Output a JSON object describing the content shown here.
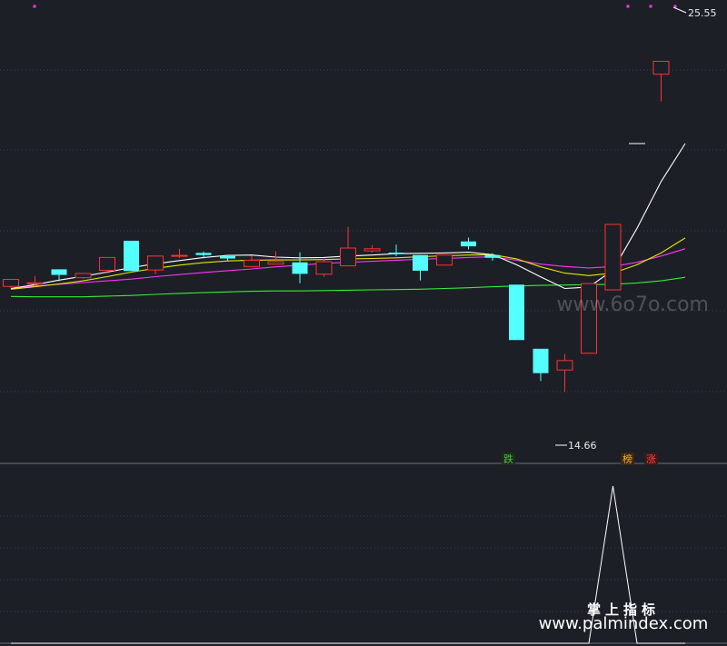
{
  "chart_data": [
    {
      "type": "candlestick",
      "ylim": [
        12.6,
        25.9
      ],
      "grid": true,
      "candles": [
        {
          "open": 17.68,
          "close": 17.88,
          "high": 17.88,
          "low": 17.62
        },
        {
          "open": 17.78,
          "close": 17.78,
          "high": 17.98,
          "low": 17.68
        },
        {
          "open": 18.17,
          "close": 18.01,
          "high": 18.17,
          "low": 17.83
        },
        {
          "open": 17.93,
          "close": 18.05,
          "high": 18.05,
          "low": 17.9
        },
        {
          "open": 18.14,
          "close": 18.51,
          "high": 18.51,
          "low": 18.05
        },
        {
          "open": 18.99,
          "close": 18.12,
          "high": 18.99,
          "low": 18.12
        },
        {
          "open": 18.15,
          "close": 18.55,
          "high": 18.55,
          "low": 18.03
        },
        {
          "open": 18.57,
          "close": 18.57,
          "high": 18.76,
          "low": 18.49
        },
        {
          "open": 18.64,
          "close": 18.58,
          "high": 18.68,
          "low": 18.48
        },
        {
          "open": 18.55,
          "close": 18.48,
          "high": 18.58,
          "low": 18.41
        },
        {
          "open": 18.25,
          "close": 18.43,
          "high": 18.56,
          "low": 18.25
        },
        {
          "open": 18.32,
          "close": 18.39,
          "high": 18.69,
          "low": 18.32
        },
        {
          "open": 18.37,
          "close": 18.04,
          "high": 18.66,
          "low": 17.77
        },
        {
          "open": 18.03,
          "close": 18.39,
          "high": 18.48,
          "low": 17.96
        },
        {
          "open": 18.27,
          "close": 18.78,
          "high": 19.39,
          "low": 18.27
        },
        {
          "open": 18.7,
          "close": 18.76,
          "high": 18.86,
          "low": 18.65
        },
        {
          "open": 18.65,
          "close": 18.61,
          "high": 18.88,
          "low": 18.55
        },
        {
          "open": 18.58,
          "close": 18.13,
          "high": 18.58,
          "low": 17.85
        },
        {
          "open": 18.29,
          "close": 18.58,
          "high": 18.58,
          "low": 18.29
        },
        {
          "open": 18.97,
          "close": 18.83,
          "high": 19.08,
          "low": 18.74
        },
        {
          "open": 18.58,
          "close": 18.5,
          "high": 18.63,
          "low": 18.42
        },
        {
          "open": 17.73,
          "close": 16.14,
          "high": 17.73,
          "low": 16.14
        },
        {
          "open": 15.89,
          "close": 15.19,
          "high": 15.89,
          "low": 14.96
        },
        {
          "open": 15.28,
          "close": 15.55,
          "high": 15.74,
          "low": 14.66
        },
        {
          "open": 15.76,
          "close": 17.76,
          "high": 17.76,
          "low": 15.76
        },
        {
          "open": 17.58,
          "close": 19.46,
          "high": 19.46,
          "low": 17.58
        },
        {
          "open": null,
          "close": null,
          "high": null,
          "low": null
        },
        {
          "open": 23.77,
          "close": 24.14,
          "high": 24.14,
          "low": 22.99
        }
      ],
      "doji_mark": {
        "index": 26,
        "value": 21.78
      },
      "ma_white": [
        17.62,
        17.73,
        17.86,
        17.97,
        18.09,
        18.22,
        18.33,
        18.42,
        18.51,
        18.57,
        18.58,
        18.52,
        18.5,
        18.51,
        18.55,
        18.58,
        18.62,
        18.63,
        18.64,
        18.66,
        18.59,
        18.3,
        17.95,
        17.62,
        17.66,
        18.15,
        19.35,
        20.69,
        21.78
      ],
      "ma_yellow": [
        17.6,
        17.67,
        17.75,
        17.84,
        17.96,
        18.09,
        18.2,
        18.29,
        18.36,
        18.41,
        18.43,
        18.44,
        18.44,
        18.45,
        18.47,
        18.48,
        18.5,
        18.53,
        18.56,
        18.58,
        18.59,
        18.47,
        18.24,
        18.06,
        17.99,
        18.06,
        18.3,
        18.64,
        19.07
      ],
      "ma_magenta": [
        17.62,
        17.69,
        17.74,
        17.79,
        17.84,
        17.89,
        17.96,
        18.02,
        18.08,
        18.13,
        18.18,
        18.24,
        18.29,
        18.34,
        18.37,
        18.4,
        18.43,
        18.46,
        18.48,
        18.51,
        18.53,
        18.43,
        18.32,
        18.25,
        18.21,
        18.25,
        18.37,
        18.55,
        18.76
      ],
      "ma_green": [
        17.39,
        17.38,
        17.38,
        17.38,
        17.4,
        17.42,
        17.45,
        17.48,
        17.5,
        17.52,
        17.54,
        17.55,
        17.55,
        17.56,
        17.57,
        17.58,
        17.59,
        17.6,
        17.62,
        17.64,
        17.67,
        17.69,
        17.71,
        17.72,
        17.73,
        17.74,
        17.78,
        17.84,
        17.94
      ],
      "max_label": "25.55",
      "min_label": "14.66",
      "colors": {
        "up": "#ff3232",
        "down": "#54ffff",
        "white": "#ffffff",
        "yellow": "#e6e600",
        "magenta": "#ff32ff",
        "green": "#33ee33",
        "grid": "#3a4150"
      }
    },
    {
      "type": "line",
      "values": [
        0,
        0,
        0,
        0,
        0,
        0,
        0,
        0,
        0,
        0,
        0,
        0,
        0,
        0,
        0,
        0,
        0,
        0,
        0,
        0,
        0,
        0,
        0,
        0,
        0,
        100,
        0,
        0,
        0
      ],
      "colors": {
        "line": "#ffffff",
        "grid": "#3a4150"
      }
    }
  ],
  "badges": [
    {
      "text": "跌",
      "color": "#33cc33",
      "bg": "#202a20"
    },
    {
      "text": "榜",
      "color": "#ffb020",
      "bg": "#3a2a10"
    },
    {
      "text": "涨",
      "color": "#ff4040",
      "bg": "#3a1a1a"
    }
  ],
  "watermark": {
    "line1": "掌上指标",
    "line2": "www.palmindex.com",
    "site_text": "www.6o7o.com"
  }
}
